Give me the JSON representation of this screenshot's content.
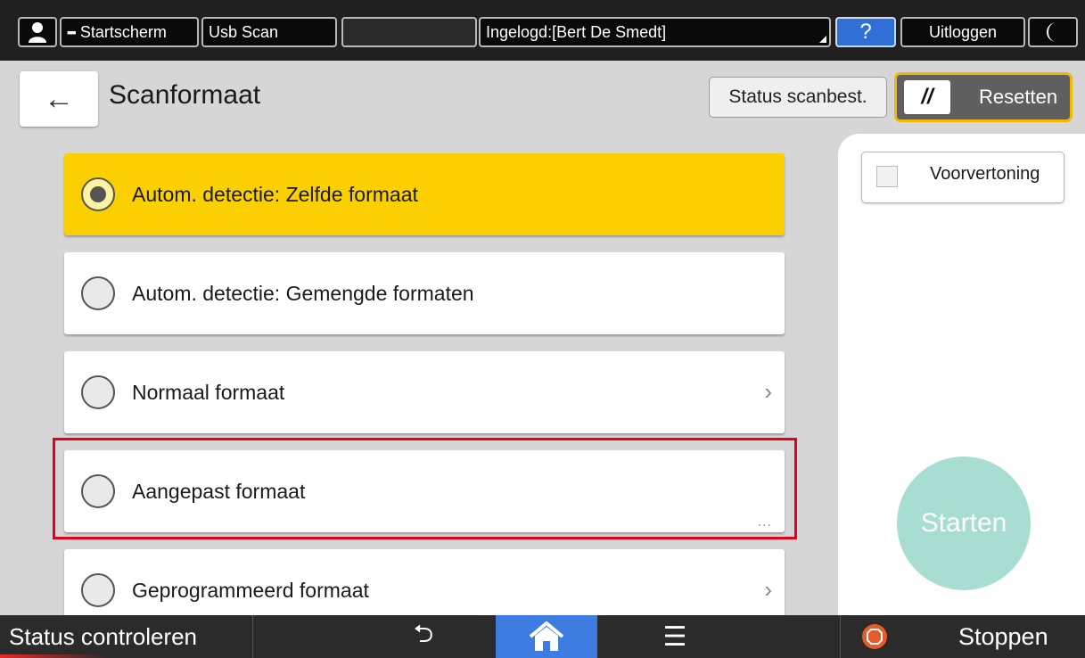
{
  "topbar": {
    "home_label": "Startscherm",
    "usb_label": "Usb Scan",
    "login_label": "Ingelogd:[Bert De Smedt]",
    "help_label": "?",
    "logout_label": "Uitloggen"
  },
  "header": {
    "back_icon": "←",
    "title": "Scanformaat",
    "status_button": "Status scanbest.",
    "reset_button": "Resetten"
  },
  "options": [
    {
      "label": "Autom. detectie: Zelfde formaat",
      "selected": true
    },
    {
      "label": "Autom. detectie: Gemengde formaten",
      "selected": false
    },
    {
      "label": "Normaal formaat",
      "selected": false,
      "has_chevron": true
    },
    {
      "label": "Aangepast formaat",
      "selected": false,
      "has_more": true,
      "highlighted": true
    },
    {
      "label": "Geprogrammeerd formaat",
      "selected": false,
      "has_chevron": true
    }
  ],
  "glyphs": {
    "chevron": "›",
    "more": "...",
    "back_arrow": "⮌",
    "menu": "☰"
  },
  "right_panel": {
    "preview_label": "Voorvertoning",
    "preview_checked": false,
    "start_label": "Starten"
  },
  "bottombar": {
    "status_label": "Status controleren",
    "stop_label": "Stoppen"
  },
  "colors": {
    "selected_option": "#fcd000",
    "highlight_border": "#e3001b",
    "start_button": "#a8ddd2",
    "home_button": "#3d7ce0",
    "reset_border": "#f2b705",
    "help_button": "#2f6fd6"
  }
}
